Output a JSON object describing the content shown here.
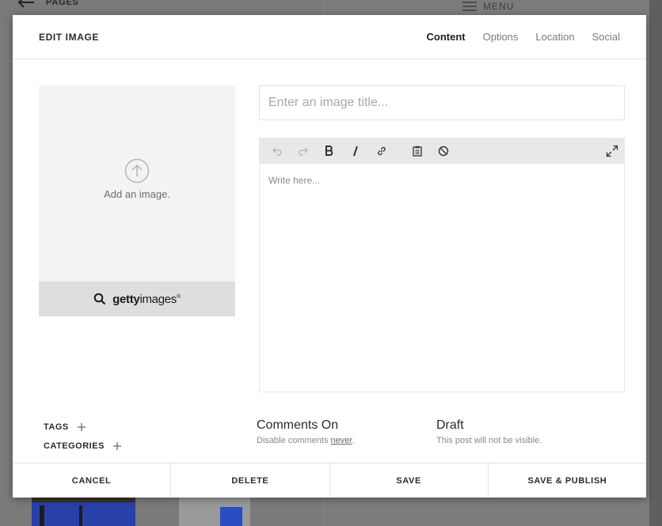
{
  "background": {
    "back_label": "PAGES",
    "menu_label": "MENU"
  },
  "modal": {
    "title": "EDIT IMAGE",
    "tabs": [
      {
        "label": "Content",
        "active": true
      },
      {
        "label": "Options",
        "active": false
      },
      {
        "label": "Location",
        "active": false
      },
      {
        "label": "Social",
        "active": false
      }
    ]
  },
  "image": {
    "add_text": "Add an image.",
    "getty": {
      "bold": "getty",
      "light": "images",
      "mark": "®"
    }
  },
  "title_input": {
    "value": "",
    "placeholder": "Enter an image title..."
  },
  "editor": {
    "toolbar": [
      "undo-icon",
      "redo-icon",
      "bold-icon",
      "italic-icon",
      "link-icon",
      "paste-icon",
      "clear-format-icon",
      "fullscreen-icon"
    ],
    "placeholder": "Write here..."
  },
  "meta": {
    "tags_label": "TAGS",
    "categories_label": "CATEGORIES",
    "comments": {
      "title": "Comments On",
      "sub_prefix": "Disable comments ",
      "sub_link": "never",
      "sub_suffix": "."
    },
    "draft": {
      "title": "Draft",
      "sub": "This post will not be visible."
    }
  },
  "footer": {
    "cancel": "CANCEL",
    "delete": "DELETE",
    "save": "SAVE",
    "save_publish": "SAVE & PUBLISH"
  }
}
